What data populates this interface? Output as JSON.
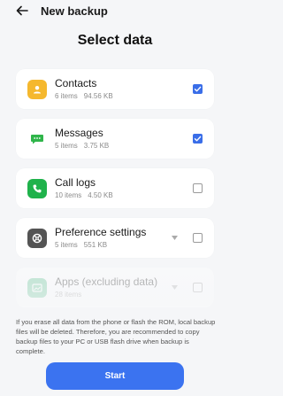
{
  "header": {
    "title": "New backup"
  },
  "heading": "Select data",
  "items": [
    {
      "name": "Contacts",
      "count": "6 items",
      "size": "94.56 KB",
      "checked": true,
      "expandable": false,
      "icon": "contacts-icon",
      "icon_color": "#f5b82e"
    },
    {
      "name": "Messages",
      "count": "5 items",
      "size": "3.75 KB",
      "checked": true,
      "expandable": false,
      "icon": "messages-icon",
      "icon_color": "#2fb54a"
    },
    {
      "name": "Call logs",
      "count": "10 items",
      "size": "4.50 KB",
      "checked": false,
      "expandable": false,
      "icon": "phone-icon",
      "icon_color": "#1fb24b"
    },
    {
      "name": "Preference settings",
      "count": "5 items",
      "size": "551 KB",
      "checked": false,
      "expandable": true,
      "icon": "settings-icon",
      "icon_color": "#545454"
    },
    {
      "name": "Apps (excluding data)",
      "count": "28 items",
      "size": "",
      "checked": false,
      "expandable": true,
      "icon": "apps-icon",
      "icon_color": "#5ac18e"
    }
  ],
  "notice": "If you erase all data from the phone or flash the ROM, local backup files will be deleted. Therefore, you are recommended to copy backup files to your PC or USB flash drive when backup is complete.",
  "start_label": "Start",
  "colors": {
    "accent": "#3b73f0",
    "background": "#f5f6f8"
  }
}
